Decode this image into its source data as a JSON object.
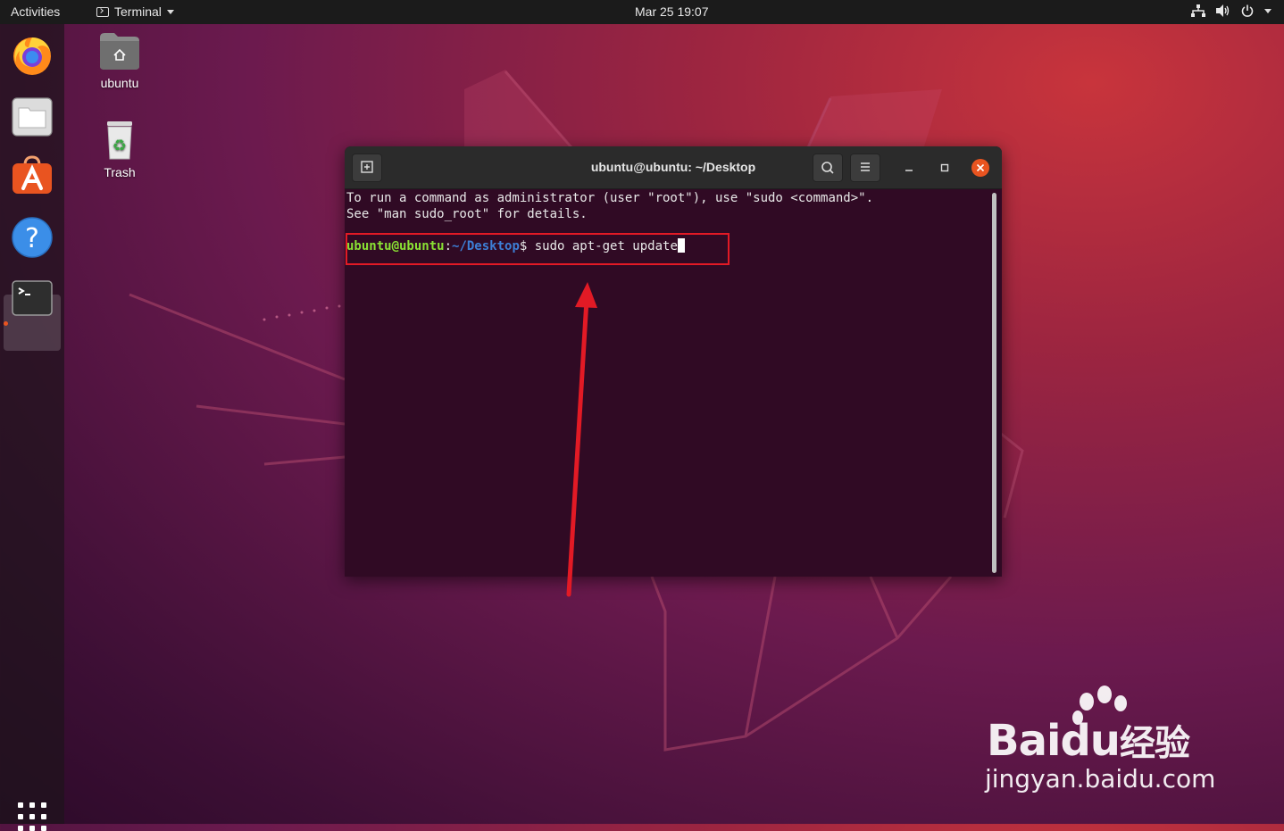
{
  "topbar": {
    "activities": "Activities",
    "app_name": "Terminal",
    "clock": "Mar 25  19:07",
    "icons": [
      "network-icon",
      "volume-icon",
      "power-icon",
      "chevron-down-icon"
    ]
  },
  "dock": {
    "items": [
      {
        "name": "Firefox",
        "icon": "firefox-icon"
      },
      {
        "name": "Files",
        "icon": "files-icon"
      },
      {
        "name": "Ubuntu Software",
        "icon": "software-icon"
      },
      {
        "name": "Help",
        "icon": "help-icon"
      },
      {
        "name": "Terminal",
        "icon": "terminal-icon",
        "running": true
      }
    ],
    "show_apps_icon": "apps-grid-icon"
  },
  "desktop": {
    "icons": [
      {
        "label": "ubuntu",
        "icon": "home-folder-icon"
      },
      {
        "label": "Trash",
        "icon": "trash-icon"
      }
    ]
  },
  "terminal": {
    "title": "ubuntu@ubuntu: ~/Desktop",
    "lines": [
      "To run a command as administrator (user \"root\"), use \"sudo <command>\".",
      "See \"man sudo_root\" for details."
    ],
    "prompt": {
      "user_host": "ubuntu@ubuntu",
      "sep": ":",
      "path": "~/Desktop",
      "symbol": "$ ",
      "command": "sudo apt-get update"
    }
  },
  "annotation": {
    "color": "#e21a25"
  },
  "watermark": {
    "brand": "Bai",
    "brand_du": "du",
    "brand_cn": "经验",
    "url": "jingyan.baidu.com"
  },
  "colors": {
    "accent": "#e95420",
    "prompt_user": "#8ae234",
    "prompt_path": "#3d7fd6",
    "terminal_bg": "#300a24"
  }
}
